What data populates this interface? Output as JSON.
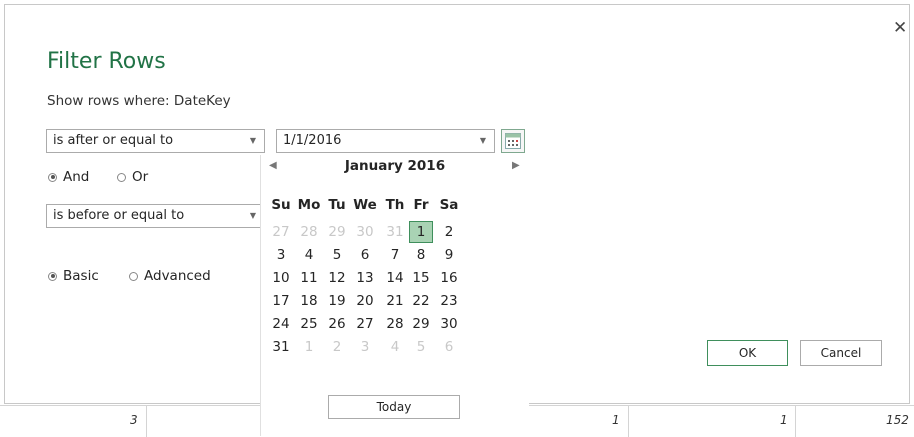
{
  "dialog": {
    "title": "Filter Rows",
    "subtitle": "Show rows where: DateKey",
    "close_glyph": "✕",
    "condition1": {
      "operator": "is after or equal to",
      "value": "1/1/2016"
    },
    "logic": {
      "options": [
        "And",
        "Or"
      ],
      "selected": "And"
    },
    "condition2": {
      "operator": "is before or equal to"
    },
    "mode": {
      "options": [
        "Basic",
        "Advanced"
      ],
      "selected": "Basic"
    },
    "ok_label": "OK",
    "cancel_label": "Cancel"
  },
  "calendar": {
    "month_label": "January 2016",
    "prev_glyph": "◀",
    "next_glyph": "▶",
    "weekdays": [
      "Su",
      "Mo",
      "Tu",
      "We",
      "Th",
      "Fr",
      "Sa"
    ],
    "weeks": [
      [
        "27",
        "28",
        "29",
        "30",
        "31",
        "1",
        "2"
      ],
      [
        "3",
        "4",
        "5",
        "6",
        "7",
        "8",
        "9"
      ],
      [
        "10",
        "11",
        "12",
        "13",
        "14",
        "15",
        "16"
      ],
      [
        "17",
        "18",
        "19",
        "20",
        "21",
        "22",
        "23"
      ],
      [
        "24",
        "25",
        "26",
        "27",
        "28",
        "29",
        "30"
      ],
      [
        "31",
        "1",
        "2",
        "3",
        "4",
        "5",
        "6"
      ]
    ],
    "selected_day": "1",
    "today_label": "Today"
  },
  "grid_cells": [
    "3",
    "1",
    "1",
    "152"
  ],
  "colors": {
    "accent": "#217346",
    "selected_day_bg": "#a9d3b4"
  }
}
